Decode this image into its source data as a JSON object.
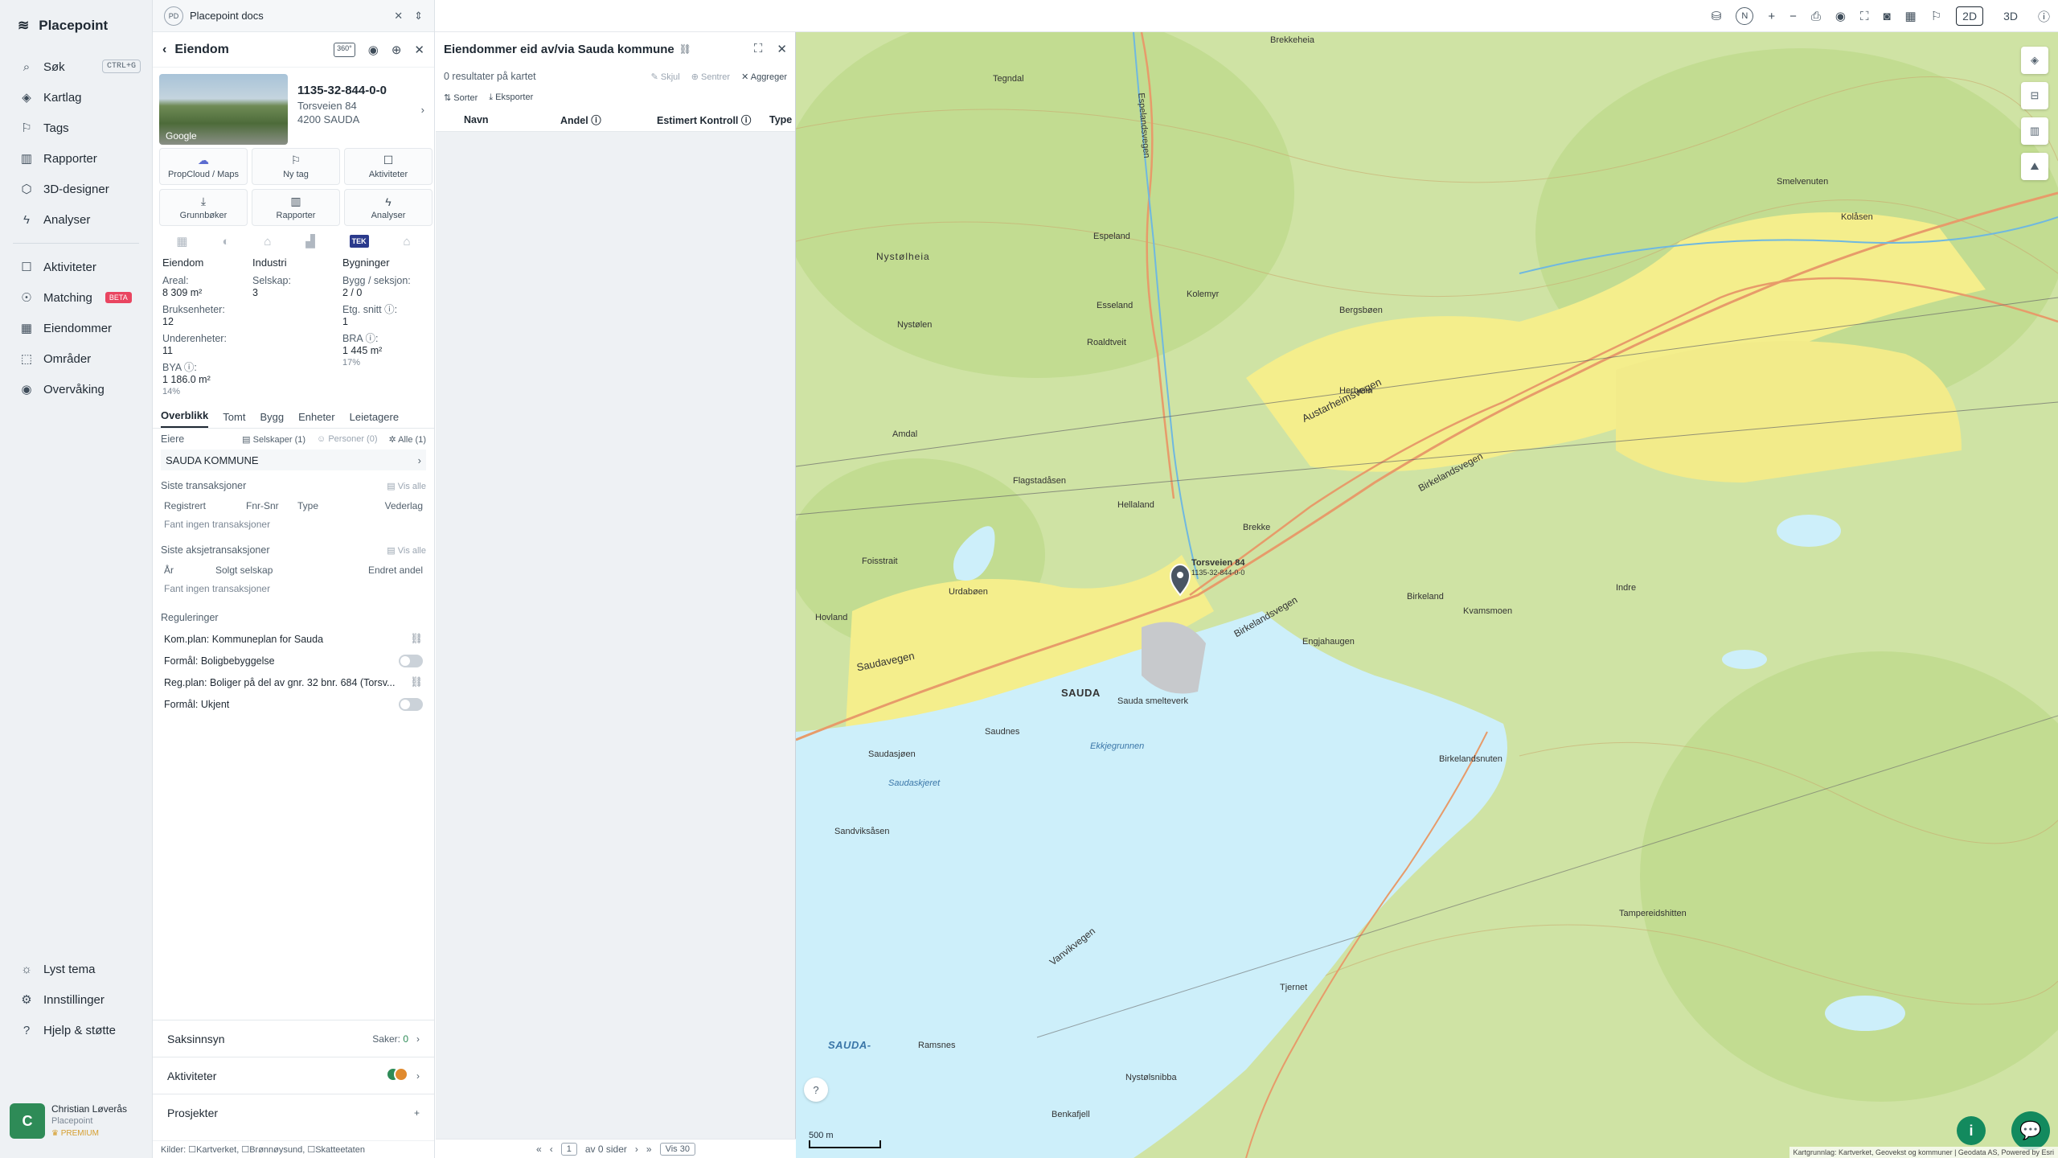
{
  "nav": {
    "brand": "Placepoint",
    "items": [
      {
        "label": "Søk",
        "shortcut": "CTRL+G",
        "icon": "search-icon"
      },
      {
        "label": "Kartlag",
        "icon": "layers-icon"
      },
      {
        "label": "Tags",
        "icon": "bookmark-icon"
      },
      {
        "label": "Rapporter",
        "icon": "bar-chart-icon"
      },
      {
        "label": "3D-designer",
        "icon": "cube-icon"
      },
      {
        "label": "Analyser",
        "icon": "bolt-icon"
      },
      {
        "label": "Aktiviteter",
        "icon": "chat-icon"
      },
      {
        "label": "Matching",
        "badge": "BETA",
        "icon": "users-icon"
      },
      {
        "label": "Eiendommer",
        "icon": "building-icon"
      },
      {
        "label": "Områder",
        "icon": "area-icon"
      },
      {
        "label": "Overvåking",
        "icon": "eye-icon"
      }
    ],
    "bottom": [
      {
        "label": "Lyst tema",
        "icon": "sun-icon"
      },
      {
        "label": "Innstillinger",
        "icon": "gear-icon"
      },
      {
        "label": "Hjelp & støtte",
        "icon": "help-icon"
      }
    ],
    "user": {
      "initial": "C",
      "name": "Christian Løverås",
      "org": "Placepoint",
      "plan": "PREMIUM"
    }
  },
  "docbar": {
    "badge": "PD",
    "title": "Placepoint docs"
  },
  "property": {
    "header": "Eiendom",
    "badge360": "360°",
    "id": "1135-32-844-0-0",
    "street": "Torsveien 84",
    "city": "4200 SAUDA",
    "thumb_label": "Google",
    "actions": [
      {
        "label": "PropCloud / Maps",
        "icon": "cloud-icon"
      },
      {
        "label": "Ny tag",
        "icon": "bookmark-icon"
      },
      {
        "label": "Aktiviteter",
        "icon": "chat-icon"
      },
      {
        "label": "Grunnbøker",
        "icon": "download-icon"
      },
      {
        "label": "Rapporter",
        "icon": "bar-chart-icon"
      },
      {
        "label": "Analyser",
        "icon": "bolt-icon"
      }
    ],
    "tek_label": "TEK",
    "stats": {
      "col1_head": "Eiendom",
      "col2_head": "Industri",
      "col3_head": "Bygninger",
      "areal_label": "Areal:",
      "areal_val": "8 309 m²",
      "bruks_label": "Bruksenheter:",
      "bruks_val": "12",
      "under_label": "Underenheter:",
      "under_val": "11",
      "bya_label": "BYA ⓘ:",
      "bya_val": "1 186.0 m²",
      "bya_pct": "14%",
      "selskap_label": "Selskap:",
      "selskap_val": "3",
      "bygg_label": "Bygg / seksjon:",
      "bygg_val": "2 / 0",
      "etg_label": "Etg. snitt ⓘ:",
      "etg_val": "1",
      "bra_label": "BRA ⓘ:",
      "bra_val": "1 445 m²",
      "bra_pct": "17%"
    },
    "tabs": [
      "Overblikk",
      "Tomt",
      "Bygg",
      "Enheter",
      "Leietagere"
    ],
    "owners": {
      "title": "Eiere",
      "f1": "Selskaper (1)",
      "f2": "Personer (0)",
      "f3": "Alle (1)",
      "owner": "SAUDA KOMMUNE"
    },
    "transactions": {
      "title": "Siste transaksjoner",
      "link": "Vis alle",
      "cols": [
        "Registrert",
        "Fnr-Snr",
        "Type",
        "Vederlag"
      ],
      "empty": "Fant ingen transaksjoner"
    },
    "share_tx": {
      "title": "Siste aksjetransaksjoner",
      "link": "Vis alle",
      "cols": [
        "År",
        "Solgt selskap",
        "Endret andel"
      ],
      "empty": "Fant ingen transaksjoner"
    },
    "regulations": {
      "title": "Reguleringer",
      "rows": [
        "Kom.plan: Kommuneplan for Sauda",
        "Formål: Boligbebyggelse",
        "Reg.plan: Boliger på del av gnr. 32 bnr. 684 (Torsv...",
        "Formål: Ukjent"
      ]
    },
    "accordions": {
      "saks": "Saksinnsyn",
      "saker_label": "Saker:",
      "saker_val": "0",
      "akt": "Aktiviteter",
      "prosj": "Prosjekter",
      "plus": "+"
    },
    "sources": "Kilder: ☐Kartverket, ☐Brønnøysund, ☐Skatteetaten"
  },
  "results": {
    "title": "Eiendommer eid av/via Sauda kommune",
    "count": "0 resultater på kartet",
    "hide": "Skjul",
    "center": "Sentrer",
    "aggregate": "Aggreger",
    "sort": "Sorter",
    "export": "Eksporter",
    "cols": [
      "Navn",
      "Andel ⓘ",
      "Estimert Kontroll ⓘ",
      "Type"
    ],
    "pager": {
      "page": "1",
      "of": "av 0 sider",
      "show": "Vis 30"
    }
  },
  "map": {
    "mode_2d": "2D",
    "mode_3d": "3D",
    "north": "N",
    "scale": "500 m",
    "marker_label": "Torsveien 84",
    "marker_sub": "1135-32-844-0-0",
    "attribution": "Kartgrunnlag: Kartverket, Geovekst og kommuner | Geodata AS, Powered by Esri",
    "labels": {
      "sauda": "SAUDA",
      "saudafjord": "SAUDA-",
      "brekkeheia": "Brekkeheia",
      "nystoelheia": "Nystølheia",
      "austarheimsvegen": "Austarheimsvegen",
      "birkelandsvegen": "Birkelandsvegen",
      "saudavegen": "Saudavegen",
      "vanvikvegen": "Vanvikvegen",
      "espelandsvegen": "Espelandsvegen",
      "saudnes": "Saudnes",
      "saudasjoen": "Saudasjøen",
      "saudaskjeret": "Saudaskjeret",
      "sandviksasen": "Sandviksåsen",
      "ramsnes": "Ramsnes",
      "nystolsnibba": "Nystølsnibba",
      "benkafjell": "Benkafjell",
      "tjernet": "Tjernet",
      "ekkjegrunnen": "Ekkjegrunnen",
      "smelteverk": "Sauda smelteverk",
      "roaldtveit": "Roaldtveit",
      "flagstadasen": "Flagstadåsen",
      "amdal": "Amdal",
      "hovland": "Hovland",
      "urdaboen": "Urdabøen",
      "hellaland": "Hellaland",
      "brekke": "Brekke",
      "kolemyr": "Kolemyr",
      "espeland": "Espeland",
      "esseland": "Esseland",
      "kvamsmoen": "Kvamsmoen",
      "birkelandsnuten": "Birkelandsnuten",
      "engjaugen": "Engjahaugen",
      "herheim": "Herheim",
      "bergsboen": "Bergsbøen",
      "kolasen": "Kolåsen",
      "smelvenuten": "Smelvenuten",
      "indre": "Indre",
      "birkeland": "Birkeland",
      "tegndal": "Tegndal",
      "foisstrait": "Foisstrait",
      "nystolen": "Nystølen",
      "tampereidshitten": "Tampereidshitten"
    }
  }
}
